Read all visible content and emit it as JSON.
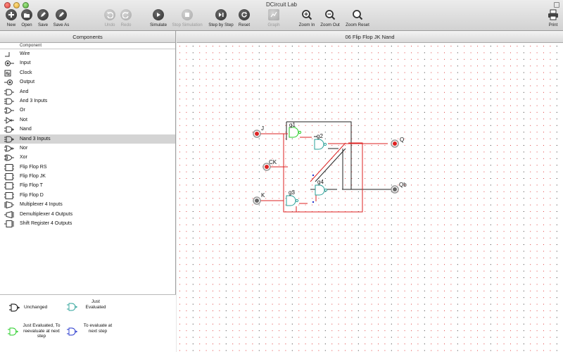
{
  "window": {
    "title": "DCircuit Lab"
  },
  "toolbar": {
    "new": "New",
    "open": "Open",
    "save": "Save",
    "save_as": "Save As",
    "undo": "Undo",
    "redo": "Redo",
    "simulate": "Simulate",
    "stop_simulation": "Stop Simulation",
    "step_by_step": "Step by Step",
    "reset": "Reset",
    "graph": "Graph",
    "zoom_in": "Zoom In",
    "zoom_out": "Zoom Out",
    "zoom_reset": "Zoom Reset",
    "print": "Print"
  },
  "components_panel": {
    "title": "Components",
    "column_header": "Component",
    "items": [
      {
        "label": "Wire",
        "icon": "wire-icon"
      },
      {
        "label": "Input",
        "icon": "input-icon"
      },
      {
        "label": "Clock",
        "icon": "clock-icon"
      },
      {
        "label": "Output",
        "icon": "output-icon"
      },
      {
        "label": "And",
        "icon": "and-gate-icon"
      },
      {
        "label": "And 3 Inputs",
        "icon": "and3-gate-icon"
      },
      {
        "label": "Or",
        "icon": "or-gate-icon"
      },
      {
        "label": "Not",
        "icon": "not-gate-icon"
      },
      {
        "label": "Nand",
        "icon": "nand-gate-icon"
      },
      {
        "label": "Nand 3 Inputs",
        "icon": "nand3-gate-icon"
      },
      {
        "label": "Nor",
        "icon": "nor-gate-icon"
      },
      {
        "label": "Xor",
        "icon": "xor-gate-icon"
      },
      {
        "label": "Flip Flop RS",
        "icon": "flipflop-icon"
      },
      {
        "label": "Flip Flop JK",
        "icon": "flipflop-icon"
      },
      {
        "label": "Flip Flop T",
        "icon": "flipflop-icon"
      },
      {
        "label": "Flip Flop D",
        "icon": "flipflop-icon"
      },
      {
        "label": "Multiplexer 4 Inputs",
        "icon": "mux-icon"
      },
      {
        "label": "Demultiplexer 4 Outputs",
        "icon": "demux-icon"
      },
      {
        "label": "Shift Register 4 Outputs",
        "icon": "shift-register-icon"
      }
    ],
    "selected": "Nand 3 Inputs"
  },
  "legend": {
    "unchanged": "Unchanged",
    "just_evaluated": "Just Evaluated",
    "just_evaluated_reevaluate": "Just Evaluated, To reevaluate at next step",
    "to_evaluate": "To evaluate at next step",
    "colors": {
      "unchanged": "#000000",
      "just_evaluated": "#2aa198",
      "reevaluate": "#22cc22",
      "to_evaluate": "#2233cc"
    }
  },
  "document": {
    "title": "06 Flip Flop JK Nand",
    "labels": {
      "j": "J",
      "ck": "CK",
      "k": "K",
      "q": "Q",
      "qb": "Qb",
      "g1": "g1",
      "g2": "g2",
      "g3": "g3",
      "g4": "g4"
    },
    "colors": {
      "active_wire": "#dd2222",
      "idle_wire": "#222222",
      "grid_dot_red": "#e04040",
      "grid_dot_black": "#333333"
    }
  }
}
